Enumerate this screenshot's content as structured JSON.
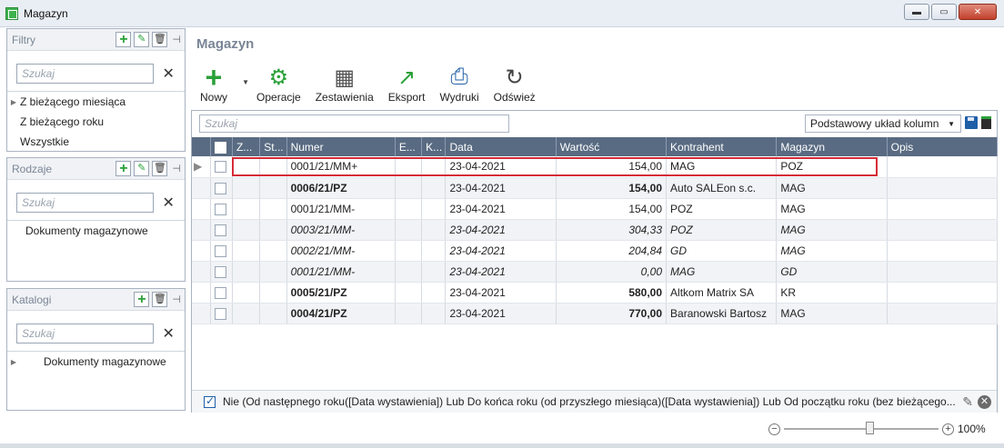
{
  "window": {
    "title": "Magazyn"
  },
  "panels": {
    "filtry": {
      "title": "Filtry",
      "search_placeholder": "Szukaj",
      "items": [
        "Z bieżącego miesiąca",
        "Z bieżącego roku",
        "Wszystkie"
      ]
    },
    "rodzaje": {
      "title": "Rodzaje",
      "search_placeholder": "Szukaj",
      "items": [
        "Dokumenty magazynowe"
      ]
    },
    "katalogi": {
      "title": "Katalogi",
      "search_placeholder": "Szukaj",
      "items": [
        "Dokumenty magazynowe"
      ]
    }
  },
  "main": {
    "title": "Magazyn",
    "toolbar": {
      "nowy": "Nowy",
      "operacje": "Operacje",
      "zestawienia": "Zestawienia",
      "eksport": "Eksport",
      "wydruki": "Wydruki",
      "odswiez": "Odśwież"
    },
    "grid_search_placeholder": "Szukaj",
    "layout_select": "Podstawowy układ kolumn",
    "columns": [
      "Z...",
      "St...",
      "Numer",
      "E...",
      "K...",
      "Data",
      "Wartość",
      "Kontrahent",
      "Magazyn",
      "Opis"
    ],
    "rows": [
      {
        "numer": "0001/21/MM+",
        "data": "23-04-2021",
        "wartosc": "154,00",
        "kontrahent": "MAG",
        "magazyn": "POZ",
        "style": "normal"
      },
      {
        "numer": "0006/21/PZ",
        "data": "23-04-2021",
        "wartosc": "154,00",
        "kontrahent": "Auto SALEon s.c.",
        "magazyn": "MAG",
        "style": "bold"
      },
      {
        "numer": "0001/21/MM-",
        "data": "23-04-2021",
        "wartosc": "154,00",
        "kontrahent": "POZ",
        "magazyn": "MAG",
        "style": "normal"
      },
      {
        "numer": "0003/21/MM-",
        "data": "23-04-2021",
        "wartosc": "304,33",
        "kontrahent": "POZ",
        "magazyn": "MAG",
        "style": "italic"
      },
      {
        "numer": "0002/21/MM-",
        "data": "23-04-2021",
        "wartosc": "204,84",
        "kontrahent": "GD",
        "magazyn": "MAG",
        "style": "italic"
      },
      {
        "numer": "0001/21/MM-",
        "data": "23-04-2021",
        "wartosc": "0,00",
        "kontrahent": "MAG",
        "magazyn": "GD",
        "style": "italic"
      },
      {
        "numer": "0005/21/PZ",
        "data": "23-04-2021",
        "wartosc": "580,00",
        "kontrahent": "Altkom Matrix SA",
        "magazyn": "KR",
        "style": "boldnum"
      },
      {
        "numer": "0004/21/PZ",
        "data": "23-04-2021",
        "wartosc": "770,00",
        "kontrahent": "Baranowski Bartosz",
        "magazyn": "MAG",
        "style": "boldnum"
      }
    ],
    "filter_text": "Nie (Od następnego roku([Data wystawienia]) Lub Do końca roku (od przyszłego miesiąca)([Data wystawienia]) Lub Od początku roku (bez bieżącego..."
  },
  "zoom": {
    "label": "100%"
  },
  "colors": {
    "header_bg": "#596b82",
    "accent_green": "#2aa038",
    "highlight_red": "#d62c37"
  }
}
